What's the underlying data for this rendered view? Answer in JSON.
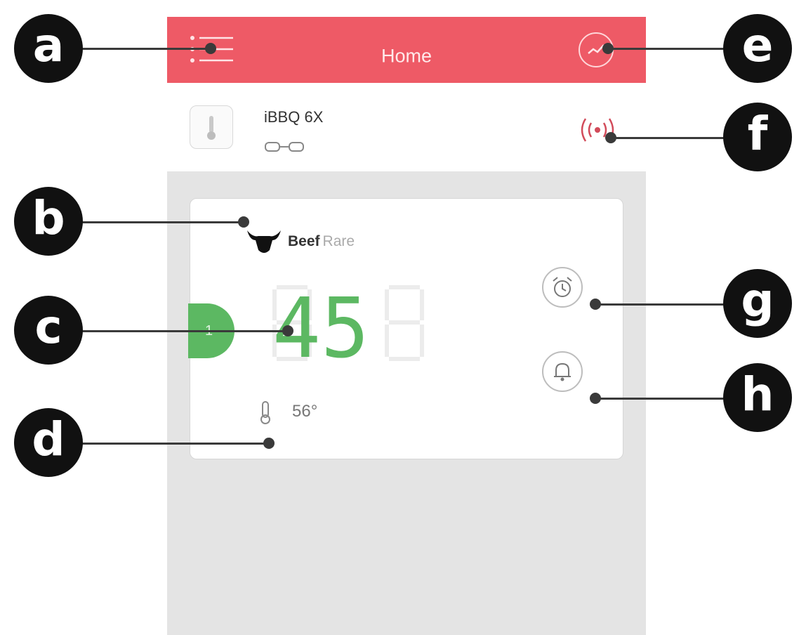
{
  "header": {
    "title": "Home",
    "menu_icon": "menu-list-icon",
    "chart_icon": "chart-icon",
    "background_color": "#ee5a66"
  },
  "device": {
    "name": "iBBQ 6X",
    "status_icon": "link-icon",
    "signal_icon": "signal-broadcast-icon"
  },
  "probe_card": {
    "meat_icon": "bull-icon",
    "meat_type": "Beef",
    "doneness": "Rare",
    "probe_number": "1",
    "current_temp": "45",
    "target_temp": "56°",
    "timer_icon": "alarm-clock-icon",
    "alert_icon": "bell-icon",
    "accent_color": "#5cb862"
  },
  "callouts": [
    "a",
    "b",
    "c",
    "d",
    "e",
    "f",
    "g",
    "h"
  ]
}
